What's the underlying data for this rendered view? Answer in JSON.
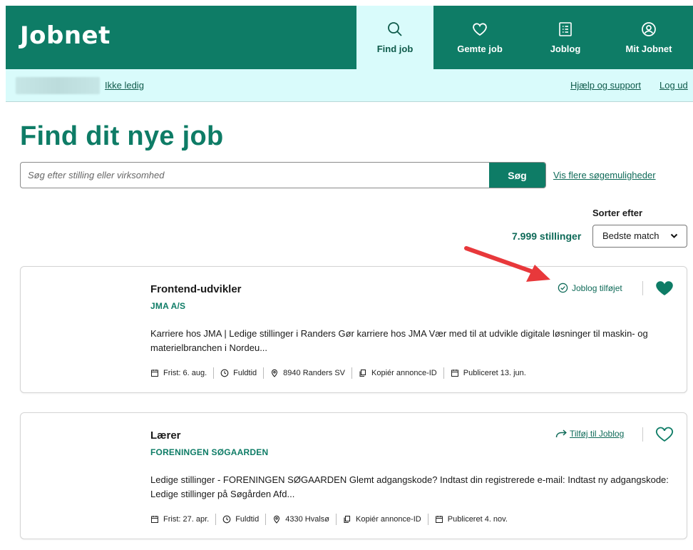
{
  "header": {
    "logo": "Jobnet",
    "nav": [
      {
        "label": "Find job",
        "icon": "search-icon",
        "active": true
      },
      {
        "label": "Gemte job",
        "icon": "heart-icon"
      },
      {
        "label": "Joblog",
        "icon": "list-icon"
      },
      {
        "label": "Mit Jobnet",
        "icon": "user-icon"
      }
    ],
    "accent": "#0e7c66",
    "subbar_bg": "#d9fbfb"
  },
  "subbar": {
    "status_link": "Ikke ledig",
    "help_link": "Hjælp og support",
    "logout_link": "Log ud"
  },
  "main": {
    "title": "Find dit nye job",
    "search": {
      "placeholder": "Søg efter stilling eller virksomhed",
      "value": "",
      "button": "Søg"
    },
    "more_options": "Vis flere søgemuligheder",
    "sort": {
      "label": "Sorter efter",
      "selected": "Bedste match"
    },
    "count": "7.999 stillinger"
  },
  "jobs": [
    {
      "title": "Frontend-udvikler",
      "company": "JMA A/S",
      "description": "Karriere hos JMA | Ledige stillinger i Randers Gør karriere hos JMA Vær med til at udvikle digitale løsninger til maskin- og materielbranchen i Nordeu...",
      "joblog_label": "Joblog tilføjet",
      "joblog_added": true,
      "saved": true,
      "meta": {
        "deadline": "Frist: 6. aug.",
        "type": "Fuldtid",
        "location": "8940 Randers SV",
        "copy": "Kopiér annonce-ID",
        "published": "Publiceret 13. jun."
      }
    },
    {
      "title": "Lærer",
      "company": "FORENINGEN SØGAARDEN",
      "description": "Ledige stillinger - FORENINGEN SØGAARDEN Glemt adgangskode? Indtast din registrerede e-mail: Indtast ny adgangskode: Ledige stillinger på Søgården Afd...",
      "joblog_label": "Tilføj til Joblog",
      "joblog_added": false,
      "saved": false,
      "meta": {
        "deadline": "Frist: 27. apr.",
        "type": "Fuldtid",
        "location": "4330 Hvalsø",
        "copy": "Kopiér annonce-ID",
        "published": "Publiceret 4. nov."
      }
    }
  ],
  "annotation_color": "#e8383b"
}
